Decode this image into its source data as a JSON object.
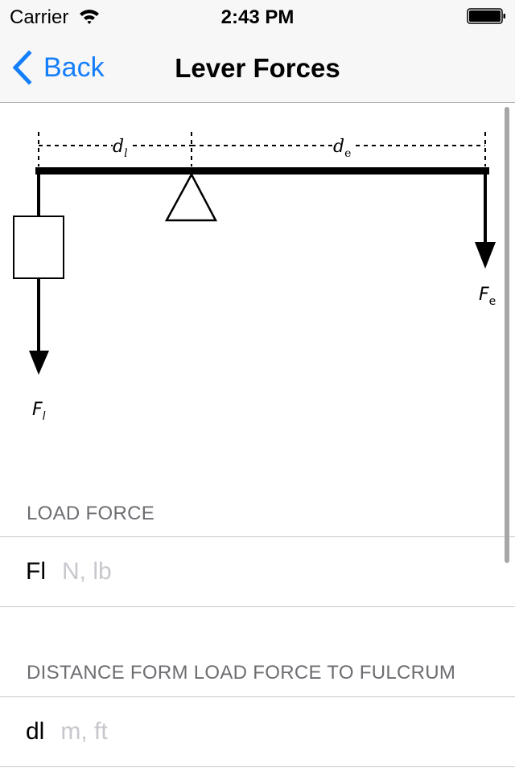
{
  "status_bar": {
    "carrier": "Carrier",
    "time": "2:43 PM",
    "wifi_icon": "wifi-icon",
    "battery_icon": "battery-icon"
  },
  "nav": {
    "back_label": "Back",
    "title": "Lever Forces",
    "back_icon": "chevron-left-icon",
    "accent_color": "#157efb"
  },
  "diagram": {
    "label_dl": "d",
    "label_dl_sub": "l",
    "label_de": "d",
    "label_de_sub": "e",
    "label_fl": "F",
    "label_fl_sub": "l",
    "label_fe": "F",
    "label_fe_sub": "e"
  },
  "sections": [
    {
      "header": "LOAD FORCE",
      "field_label": "Fl",
      "placeholder": "N, lb",
      "value": ""
    },
    {
      "header": "DISTANCE FORM LOAD FORCE TO FULCRUM",
      "field_label": "dl",
      "placeholder": "m, ft",
      "value": ""
    }
  ]
}
